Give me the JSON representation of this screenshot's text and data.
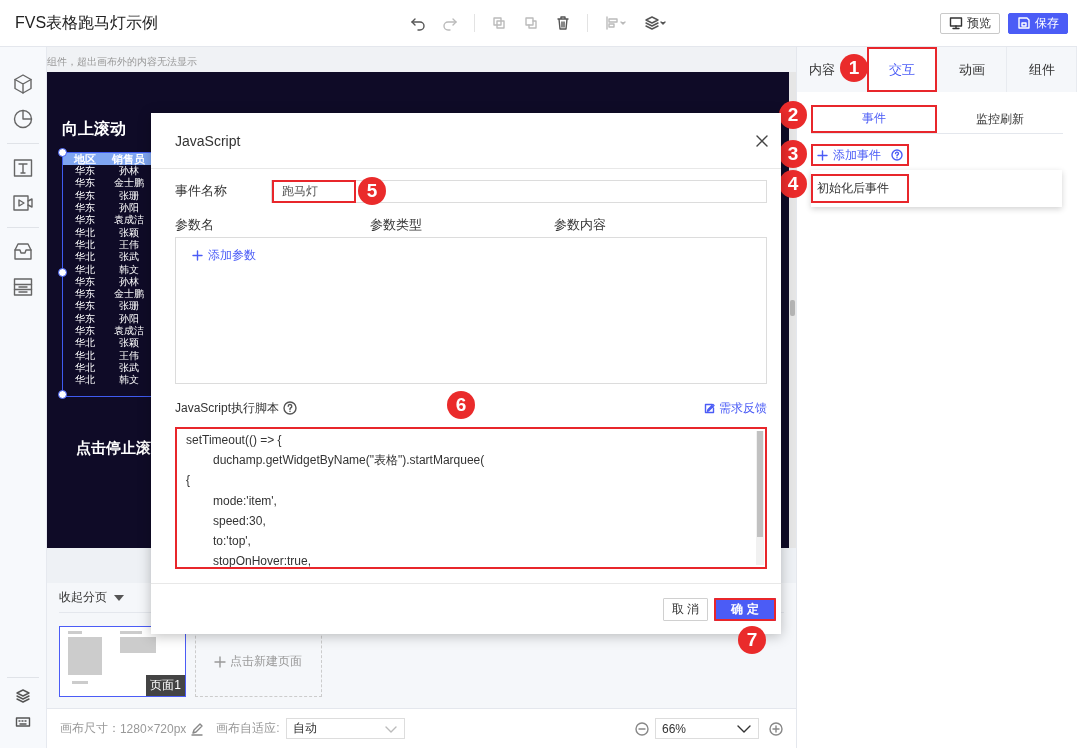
{
  "app": {
    "title": "FVS表格跑马灯示例",
    "preview": "预览",
    "save": "保存"
  },
  "canvas": {
    "notice": "组件，超出画布外的内容无法显示",
    "heading": "向上滚动",
    "button_text": "点击停止滚",
    "table": {
      "columns": [
        "地区",
        "销售员"
      ],
      "rows": [
        [
          "华东",
          "孙林"
        ],
        [
          "华东",
          "金士鹏"
        ],
        [
          "华东",
          "张珊"
        ],
        [
          "华东",
          "孙阳"
        ],
        [
          "华东",
          "袁成洁"
        ],
        [
          "华北",
          "张颖"
        ],
        [
          "华北",
          "王伟"
        ],
        [
          "华北",
          "张武"
        ],
        [
          "华北",
          "韩文"
        ],
        [
          "华东",
          "孙林"
        ],
        [
          "华东",
          "金士鹏"
        ],
        [
          "华东",
          "张珊"
        ],
        [
          "华东",
          "孙阳"
        ],
        [
          "华东",
          "袁成洁"
        ],
        [
          "华北",
          "张颖"
        ],
        [
          "华北",
          "王伟"
        ],
        [
          "华北",
          "张武"
        ],
        [
          "华北",
          "韩文"
        ]
      ]
    }
  },
  "pages": {
    "collapse": "收起分页",
    "items": [
      {
        "label": "页面1",
        "selected": true
      }
    ],
    "new_page": "点击新建页面"
  },
  "footer": {
    "size_label": "画布尺寸：",
    "size": "1280×720px",
    "fit_label": "画布自适应:",
    "fit": "自动",
    "zoom": "66%"
  },
  "panel": {
    "tabs": [
      {
        "label": "内容",
        "selected": false
      },
      {
        "label": "交互",
        "selected": true,
        "callout": "1"
      },
      {
        "label": "动画",
        "selected": false
      },
      {
        "label": "组件",
        "selected": false
      }
    ],
    "subtabs": [
      {
        "label": "事件",
        "selected": true,
        "callout": "2"
      },
      {
        "label": "监控刷新",
        "selected": false
      }
    ],
    "add_event": {
      "label": "添加事件",
      "callout": "3"
    },
    "events": [
      {
        "label": "初始化后事件",
        "callout": "4"
      }
    ]
  },
  "dialog": {
    "title": "JavaScript",
    "event_name": {
      "label": "事件名称",
      "value": "跑马灯",
      "callout": "5"
    },
    "param_columns": [
      "参数名",
      "参数类型",
      "参数内容"
    ],
    "add_param": "添加参数",
    "script": {
      "label": "JavaScript执行脚本",
      "feedback": "需求反馈",
      "callout": "6",
      "lines": [
        "setTimeout(() => {",
        "\tduchamp.getWidgetByName(\"表格\").startMarquee(",
        "{",
        "\tmode:'item',",
        "\tspeed:30,",
        "\tto:'top',",
        "\tstopOnHover:true,"
      ]
    },
    "cancel": "取 消",
    "ok": {
      "label": "确 定",
      "callout": "7"
    }
  }
}
